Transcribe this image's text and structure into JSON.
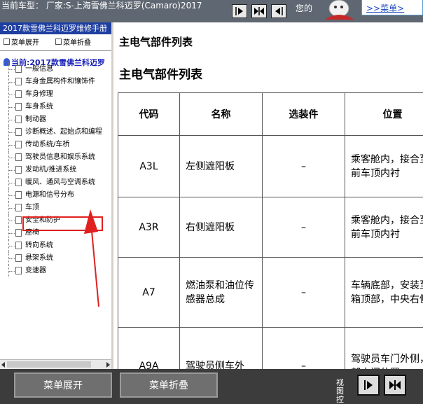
{
  "header": {
    "vehicle_label": "当前车型： 厂家:S-上海雪佛兰科迈罗(Camaro)2017",
    "welcome": "您的",
    "menu_link": ">>菜单>"
  },
  "sidebar": {
    "manual_title": "2017款雪佛兰科迈罗维修手册",
    "expand_label": "菜单展开",
    "collapse_label": "菜单折叠",
    "current": "当前:2017款雪佛兰科迈罗",
    "items": [
      {
        "label": "一般信息"
      },
      {
        "label": "车身金属构件和镶饰件"
      },
      {
        "label": "车身修理"
      },
      {
        "label": "车身系统"
      },
      {
        "label": "制动器"
      },
      {
        "label": "诊断概述、起始点和编程"
      },
      {
        "label": "传动系统/车桥"
      },
      {
        "label": "驾驶员信息和娱乐系统"
      },
      {
        "label": "发动机/推进系统"
      },
      {
        "label": "暖风、通风与空调系统"
      },
      {
        "label": "电源和信号分布"
      },
      {
        "label": "车顶"
      },
      {
        "label": "安全和防护"
      },
      {
        "label": "座椅"
      },
      {
        "label": "转向系统"
      },
      {
        "label": "悬架系统"
      },
      {
        "label": "变速器"
      }
    ]
  },
  "content": {
    "page_heading": "主电气部件列表",
    "table_heading": "主电气部件列表",
    "columns": [
      "代码",
      "名称",
      "选装件",
      "位置"
    ],
    "rows": [
      {
        "code": "A3L",
        "name": "左侧遮阳板",
        "option": "–",
        "location": "乘客舱内，接合至左前车顶内衬"
      },
      {
        "code": "A3R",
        "name": "右侧遮阳板",
        "option": "–",
        "location": "乘客舱内，接合至右前车顶内衬"
      },
      {
        "code": "A7",
        "name": "燃油泵和油位传感器总成",
        "option": "–",
        "location": "车辆底部，安装至油箱顶部，中央右侧"
      },
      {
        "code": "A9A",
        "name": "驾驶员侧车外",
        "option": "–",
        "location": "驾驶员车门外侧，前部中间位置"
      }
    ]
  },
  "bottom": {
    "expand_button": "菜单展开",
    "collapse_button": "菜单折叠",
    "view_label": "视图控"
  }
}
